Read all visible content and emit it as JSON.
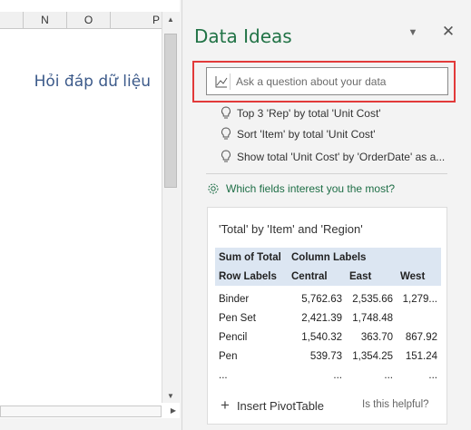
{
  "sheet": {
    "columns": [
      "",
      "N",
      "O",
      "P"
    ],
    "caption": "Hỏi đáp dữ liệu"
  },
  "pane": {
    "title": "Data Ideas",
    "menu_icon": "chevron-down-icon",
    "close_icon": "close-icon",
    "search": {
      "placeholder": "Ask a question about your data",
      "icon": "line-chart-icon",
      "highlight_color": "#e23a3a"
    },
    "suggestions": [
      {
        "icon": "lightbulb-icon",
        "text": "Top 3 'Rep' by total 'Unit Cost'"
      },
      {
        "icon": "lightbulb-icon",
        "text": "Sort 'Item' by total 'Unit Cost'"
      },
      {
        "icon": "lightbulb-icon",
        "text": "Show total 'Unit Cost' by 'OrderDate' as a..."
      }
    ],
    "fields_link": {
      "icon": "gear-icon",
      "text": "Which fields interest you the most?"
    },
    "card": {
      "title": "'Total' by 'Item' and 'Region'",
      "header_row1": [
        "Sum of Total",
        "Column Labels",
        "",
        ""
      ],
      "header_row2": [
        "Row Labels",
        "Central",
        "East",
        "West"
      ],
      "rows": [
        [
          "Binder",
          "5,762.63",
          "2,535.66",
          "1,279..."
        ],
        [
          "Pen Set",
          "2,421.39",
          "1,748.48",
          ""
        ],
        [
          "Pencil",
          "1,540.32",
          "363.70",
          "867.92"
        ],
        [
          "Pen",
          "539.73",
          "1,354.25",
          "151.24"
        ],
        [
          "...",
          "...",
          "...",
          "..."
        ]
      ],
      "insert_label": "Insert PivotTable",
      "insert_icon": "plus-icon",
      "helpful_label": "Is this helpful?"
    },
    "accent_color": "#217346"
  }
}
